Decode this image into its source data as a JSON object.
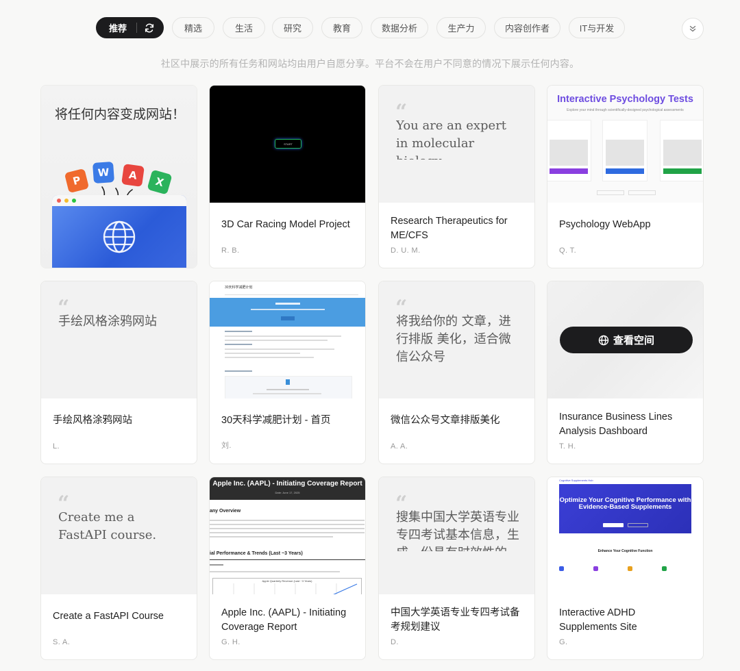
{
  "filters": {
    "active": "推荐",
    "items": [
      "精选",
      "生活",
      "研究",
      "教育",
      "数据分析",
      "生产力",
      "内容创作者",
      "IT与开发"
    ]
  },
  "notice": "社区中展示的所有任务和网站均由用户自愿分享。平台不会在用户不同意的情况下展示任何内容。",
  "cards": [
    {
      "title": "",
      "author": "",
      "hero_text": "将任何内容变成网站！",
      "tiles": [
        "P",
        "W",
        "A",
        "X"
      ]
    },
    {
      "title": "3D Car Racing Model Project",
      "author": "R. B.",
      "start_label": "START"
    },
    {
      "title": "Research Therapeutics for ME/CFS",
      "author": "D. U. M.",
      "quote": "You are an expert in molecular biology, immunology and"
    },
    {
      "title": "Psychology WebApp",
      "author": "Q. T.",
      "thumb_title": "Interactive Psychology Tests",
      "thumb_sub": "Explore your mind through scientifically-designed psychological assessments"
    },
    {
      "title": "手绘风格涂鸦网站",
      "author": "L.",
      "quote": "手绘风格涂鸦网站"
    },
    {
      "title": "30天科学减肥计划 - 首页",
      "author": "刘.",
      "thumb_brand": "30天科学减肥计划"
    },
    {
      "title": "微信公众号文章排版美化",
      "author": "A. A.",
      "quote": "将我给你的 文章，进行排版 美化，适合微信公众号"
    },
    {
      "title": "Insurance Business Lines Analysis Dashboard",
      "author": "T. H.",
      "space_label": "查看空间"
    },
    {
      "title": "Create a FastAPI Course",
      "author": "S. A.",
      "quote": "Create me a FastAPI course."
    },
    {
      "title": "Apple Inc. (AAPL) - Initiating Coverage Report",
      "author": "G. H.",
      "thumb_title": "Apple Inc. (AAPL) - Initiating Coverage Report",
      "thumb_h1": "any Overview",
      "thumb_h2": "ial Performance & Trends (Last ~3 Years)",
      "thumb_chart": "Apple Quarterly Revenue (Last ~3 Years)"
    },
    {
      "title": "中国大学英语专业专四考试备考规划建议",
      "author": "D.",
      "quote": "搜集中国大学英语专业专四考试基本信息，生成一份具有时效性的"
    },
    {
      "title": "Interactive ADHD Supplements Site",
      "author": "G.",
      "thumb_title": "Optimize Your Cognitive Performance with Evidence-Based Supplements",
      "thumb_section": "Enhance Your Cognitive Function"
    }
  ],
  "colors": {
    "active_chip": "#1c1c1e",
    "psych_accent": "#6d4ce0",
    "adhd_hero": "#3b3fd6",
    "weightloss_hero": "#4b9de1"
  }
}
